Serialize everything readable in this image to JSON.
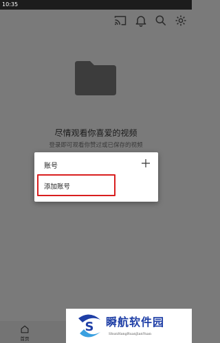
{
  "status_bar": {
    "time": "10:35"
  },
  "toolbar": {
    "icons": [
      "cast-icon",
      "bell-icon",
      "search-icon",
      "gear-icon"
    ]
  },
  "empty_state": {
    "icon": "folder-icon",
    "headline": "尽情观看你喜爱的视频",
    "subline": "登录即可观看你赞过或已保存的视频"
  },
  "dialog": {
    "title": "账号",
    "add_icon": "plus-icon",
    "add_account_label": "添加账号",
    "highlight_color": "#d81e1e"
  },
  "bottom_nav": {
    "home_label": "首页"
  },
  "watermark": {
    "title": "瞬航软件园",
    "subtitle": "ShunHangRuanJianYuan"
  },
  "colors": {
    "scrim_bg": "#7a7a7a",
    "status_bar": "#1c1c1c",
    "dialog_bg": "#ffffff",
    "watermark_blue": "#1f3fa6"
  }
}
